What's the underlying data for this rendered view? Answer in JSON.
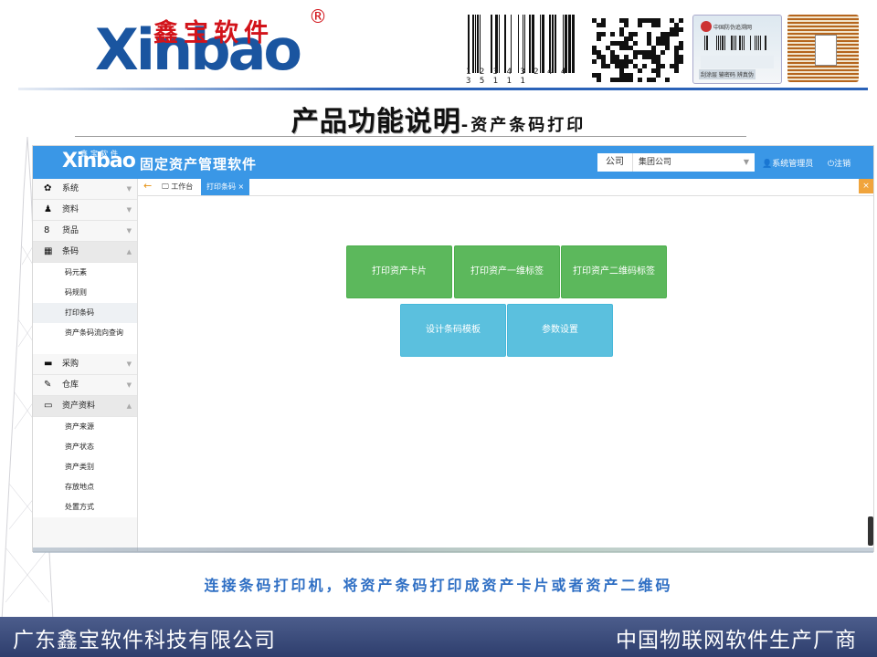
{
  "slide": {
    "brand_cn": "鑫宝软件",
    "brand_en": "Xinbao",
    "brand_reg": "®",
    "barcode_digits": "1 2 3 4 3 2 4   4 3 5 1 1 1",
    "label_title": "中国防伪追溯网",
    "label_foot": "刮涂层 输密码 辨真伪",
    "title_main": "产品功能说明",
    "title_sub": "-资产条码打印",
    "caption": "连接条码打印机，将资产条码打印成资产卡片或者资产二维码",
    "footer_left": "广东鑫宝软件科技有限公司",
    "footer_right": "中国物联网软件生产厂商"
  },
  "app": {
    "logo_en": "Xinbao",
    "logo_cn": "鑫宝软件",
    "logo_reg": "®",
    "title": "固定资产管理软件",
    "company_label": "公司",
    "company_value": "集团公司",
    "user": "系统管理员",
    "logout": "注销",
    "tabs": {
      "home": "工作台",
      "active": "打印条码",
      "close_symbol": "×"
    },
    "sidebar": {
      "items": [
        {
          "label": "系统",
          "icon": "gear-icon"
        },
        {
          "label": "资料",
          "icon": "user-icon"
        },
        {
          "label": "货品",
          "icon": "box-icon"
        },
        {
          "label": "条码",
          "icon": "qrcode-icon"
        }
      ],
      "barcode_sub": [
        "码元素",
        "码规则",
        "打印条码",
        "资产条码流向查询"
      ],
      "items2": [
        {
          "label": "采购",
          "icon": "card-icon"
        },
        {
          "label": "仓库",
          "icon": "edit-icon"
        },
        {
          "label": "资产资料",
          "icon": "monitor-icon"
        }
      ],
      "asset_sub": [
        "资产来源",
        "资产状态",
        "资产类别",
        "存放地点",
        "处置方式"
      ]
    },
    "buttons": {
      "print_card": "打印资产卡片",
      "print_1d": "打印资产一维标签",
      "print_2d": "打印资产二维码标签",
      "design_template": "设计条码模板",
      "settings": "参数设置"
    }
  },
  "colors": {
    "topbar": "#3a97e6",
    "green_button": "#5cb85c",
    "cyan_button": "#5bc0de",
    "caption": "#2f6fc4",
    "footer": "#2e3e6d"
  }
}
